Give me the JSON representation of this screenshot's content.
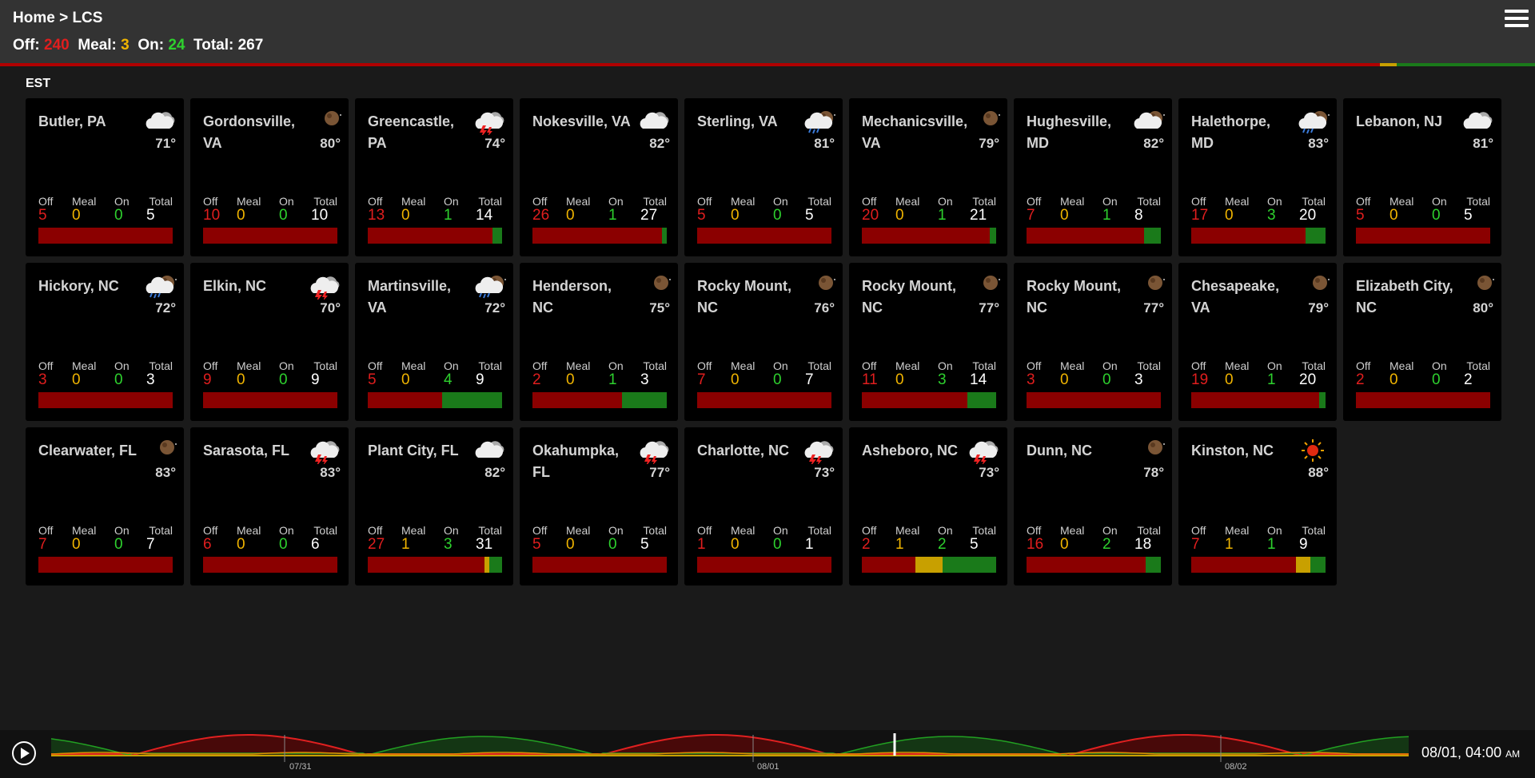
{
  "header": {
    "breadcrumb": "Home > LCS",
    "summary": {
      "off_label": "Off:",
      "off": "240",
      "meal_label": "Meal:",
      "meal": "3",
      "on_label": "On:",
      "on": "24",
      "total_label": "Total:",
      "total": "267"
    },
    "menu_icon": "hamburger-menu-icon"
  },
  "timezone": "EST",
  "column_labels": {
    "off": "Off",
    "meal": "Meal",
    "on": "On",
    "total": "Total"
  },
  "colors": {
    "off": "#8b0000",
    "meal": "#c8a000",
    "on": "#1a7a1a",
    "off_text": "#e01e1e",
    "meal_text": "#f0b400",
    "on_text": "#2ed12e"
  },
  "cards": [
    {
      "name": "Butler, PA",
      "temp": "71°",
      "weather": "cloudy",
      "off": "5",
      "meal": "0",
      "on": "0",
      "total": "5"
    },
    {
      "name": "Gordonsville, VA",
      "temp": "80°",
      "weather": "night",
      "off": "10",
      "meal": "0",
      "on": "0",
      "total": "10"
    },
    {
      "name": "Greencastle, PA",
      "temp": "74°",
      "weather": "thunderstorm",
      "off": "13",
      "meal": "0",
      "on": "1",
      "total": "14"
    },
    {
      "name": "Nokesville, VA",
      "temp": "82°",
      "weather": "cloudy",
      "off": "26",
      "meal": "0",
      "on": "1",
      "total": "27"
    },
    {
      "name": "Sterling, VA",
      "temp": "81°",
      "weather": "rain-night",
      "off": "5",
      "meal": "0",
      "on": "0",
      "total": "5"
    },
    {
      "name": "Mechanicsville, VA",
      "temp": "79°",
      "weather": "night",
      "off": "20",
      "meal": "0",
      "on": "1",
      "total": "21"
    },
    {
      "name": "Hughesville, MD",
      "temp": "82°",
      "weather": "cloudy-night",
      "off": "7",
      "meal": "0",
      "on": "1",
      "total": "8"
    },
    {
      "name": "Halethorpe, MD",
      "temp": "83°",
      "weather": "rain-night",
      "off": "17",
      "meal": "0",
      "on": "3",
      "total": "20"
    },
    {
      "name": "Lebanon, NJ",
      "temp": "81°",
      "weather": "cloudy",
      "off": "5",
      "meal": "0",
      "on": "0",
      "total": "5"
    },
    {
      "name": "Hickory, NC",
      "temp": "72°",
      "weather": "rain-night",
      "off": "3",
      "meal": "0",
      "on": "0",
      "total": "3"
    },
    {
      "name": "Elkin, NC",
      "temp": "70°",
      "weather": "thunderstorm",
      "off": "9",
      "meal": "0",
      "on": "0",
      "total": "9"
    },
    {
      "name": "Martinsville, VA",
      "temp": "72°",
      "weather": "rain-night",
      "off": "5",
      "meal": "0",
      "on": "4",
      "total": "9"
    },
    {
      "name": "Henderson, NC",
      "temp": "75°",
      "weather": "night",
      "off": "2",
      "meal": "0",
      "on": "1",
      "total": "3"
    },
    {
      "name": "Rocky Mount, NC",
      "temp": "76°",
      "weather": "night",
      "off": "7",
      "meal": "0",
      "on": "0",
      "total": "7"
    },
    {
      "name": "Rocky Mount, NC",
      "temp": "77°",
      "weather": "night",
      "off": "11",
      "meal": "0",
      "on": "3",
      "total": "14"
    },
    {
      "name": "Rocky Mount, NC",
      "temp": "77°",
      "weather": "night",
      "off": "3",
      "meal": "0",
      "on": "0",
      "total": "3"
    },
    {
      "name": "Chesapeake, VA",
      "temp": "79°",
      "weather": "night",
      "off": "19",
      "meal": "0",
      "on": "1",
      "total": "20"
    },
    {
      "name": "Elizabeth City, NC",
      "temp": "80°",
      "weather": "night",
      "off": "2",
      "meal": "0",
      "on": "0",
      "total": "2"
    },
    {
      "name": "Clearwater, FL",
      "temp": "83°",
      "weather": "night",
      "off": "7",
      "meal": "0",
      "on": "0",
      "total": "7"
    },
    {
      "name": "Sarasota, FL",
      "temp": "83°",
      "weather": "thunderstorm",
      "off": "6",
      "meal": "0",
      "on": "0",
      "total": "6"
    },
    {
      "name": "Plant City, FL",
      "temp": "82°",
      "weather": "cloudy",
      "off": "27",
      "meal": "1",
      "on": "3",
      "total": "31"
    },
    {
      "name": "Okahumpka, FL",
      "temp": "77°",
      "weather": "thunderstorm",
      "off": "5",
      "meal": "0",
      "on": "0",
      "total": "5"
    },
    {
      "name": "Charlotte, NC",
      "temp": "73°",
      "weather": "thunderstorm",
      "off": "1",
      "meal": "0",
      "on": "0",
      "total": "1"
    },
    {
      "name": "Asheboro, NC",
      "temp": "73°",
      "weather": "thunderstorm",
      "off": "2",
      "meal": "1",
      "on": "2",
      "total": "5"
    },
    {
      "name": "Dunn, NC",
      "temp": "78°",
      "weather": "night",
      "off": "16",
      "meal": "0",
      "on": "2",
      "total": "18"
    },
    {
      "name": "Kinston, NC",
      "temp": "88°",
      "weather": "sunny",
      "off": "7",
      "meal": "1",
      "on": "1",
      "total": "9"
    }
  ],
  "timeline": {
    "play_icon": "play-icon",
    "ticks": [
      "07/31",
      "08/01",
      "08/02"
    ],
    "current": "08/01, 04:00",
    "current_suffix": "AM"
  }
}
